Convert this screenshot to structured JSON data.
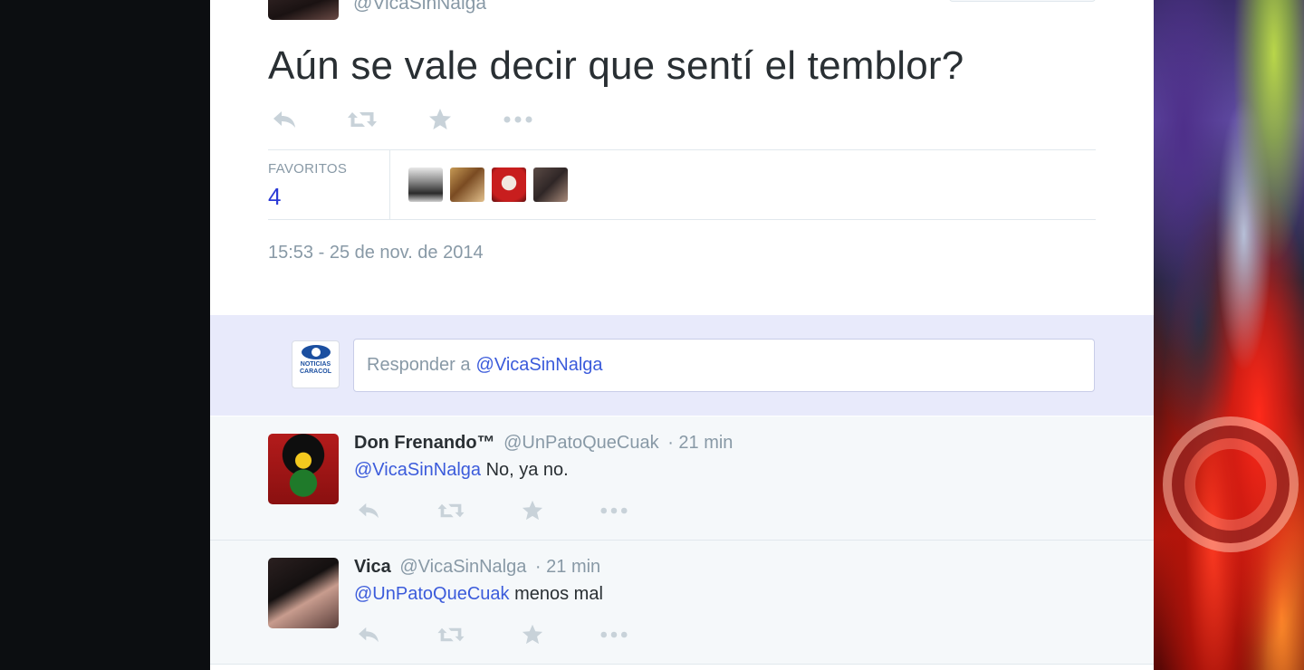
{
  "main_tweet": {
    "author_handle": "@VicaSinNalga",
    "text": "Aún se vale decir que sentí el temblor?",
    "favorites_label": "FAVORITOS",
    "favorites_count": "4",
    "timestamp": "15:53 - 25 de nov. de 2014",
    "actions": [
      "reply-icon",
      "retweet-icon",
      "favorite-star-icon",
      "more-icon"
    ]
  },
  "reply_box": {
    "placeholder_prefix": "Responder a",
    "placeholder_mention": "@VicaSinNalga",
    "user_avatar_logo_text": "NOTICIAS CARACOL"
  },
  "replies": [
    {
      "name": "Don Frenando™",
      "handle": "@UnPatoQueCuak",
      "time": "· 21 min",
      "mention": "@VicaSinNalga",
      "text": " No, ya no."
    },
    {
      "name": "Vica",
      "handle": "@VicaSinNalga",
      "time": "· 21 min",
      "mention": "@UnPatoQueCuak",
      "text": " menos mal"
    }
  ],
  "colors": {
    "link": "#3b5bdb",
    "text": "#292f33",
    "muted": "#8899a6",
    "reply_area": "#e8eafb",
    "icon": "#c8d2d9"
  }
}
